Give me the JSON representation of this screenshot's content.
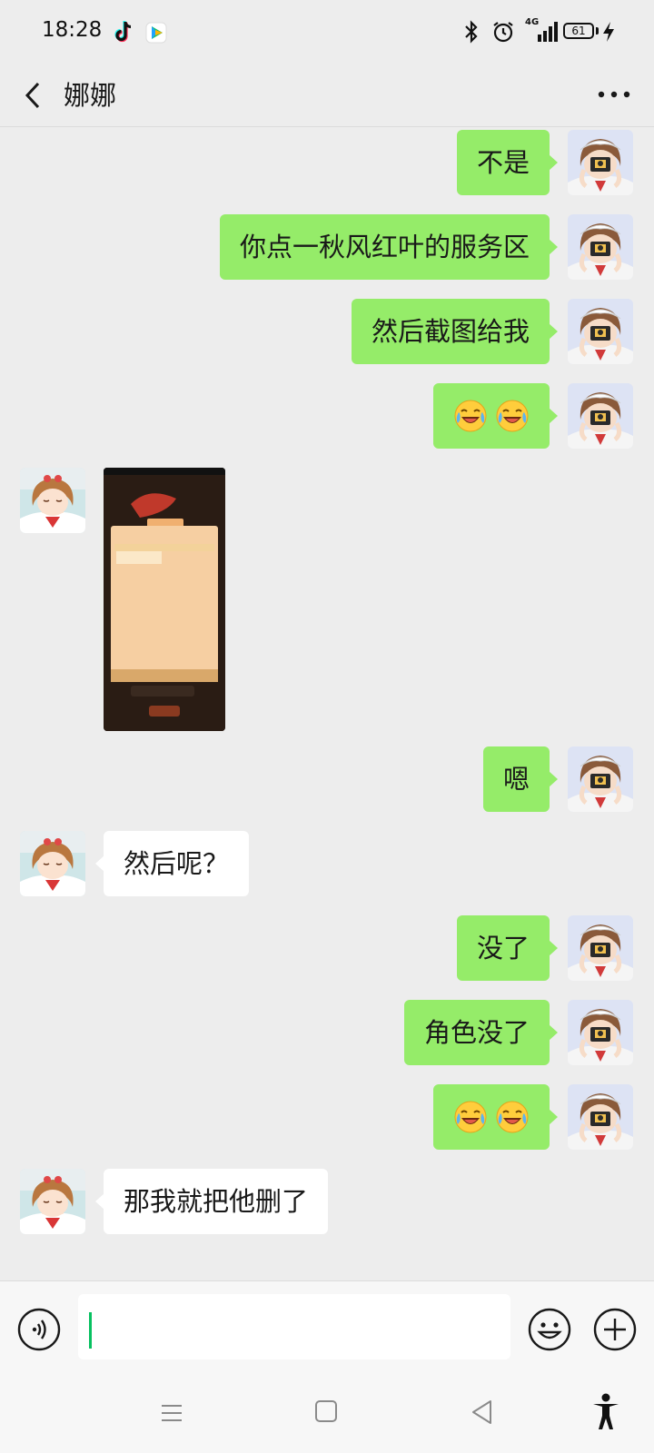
{
  "status_bar": {
    "time": "18:28",
    "network": "4G",
    "battery": "61",
    "battery_level_percent": 61,
    "icons": [
      "tiktok-icon",
      "video-app-icon",
      "bluetooth-icon",
      "alarm-icon",
      "signal-icon",
      "battery-icon",
      "charging-icon"
    ]
  },
  "header": {
    "title": "娜娜",
    "back_icon": "chevron-left-icon",
    "more_icon": "more-dots-icon"
  },
  "messages": [
    {
      "from": "me",
      "type": "text",
      "text": "不是"
    },
    {
      "from": "me",
      "type": "text",
      "text": "你点一秋风红叶的服务区"
    },
    {
      "from": "me",
      "type": "text",
      "text": "然后截图给我"
    },
    {
      "from": "me",
      "type": "emoji",
      "emoji": [
        "laughing-crying-emoji",
        "laughing-crying-emoji"
      ]
    },
    {
      "from": "her",
      "type": "image",
      "image": "game-screenshot-thumbnail"
    },
    {
      "from": "me",
      "type": "text",
      "text": "嗯"
    },
    {
      "from": "her",
      "type": "text",
      "text": "然后呢？"
    },
    {
      "from": "me",
      "type": "text",
      "text": "没了"
    },
    {
      "from": "me",
      "type": "text",
      "text": "角色没了"
    },
    {
      "from": "me",
      "type": "emoji",
      "emoji": [
        "laughing-crying-emoji",
        "laughing-crying-emoji"
      ]
    },
    {
      "from": "her",
      "type": "text",
      "text": "那我就把他删了"
    }
  ],
  "input_bar": {
    "value": "",
    "voice_icon": "voice-icon",
    "emoji_icon": "smiley-icon",
    "plus_icon": "plus-icon"
  },
  "nav_bar": {
    "icons": [
      "menu-icon",
      "home-square-icon",
      "back-triangle-icon",
      "accessibility-icon"
    ]
  },
  "colors": {
    "background": "#ededed",
    "my_bubble": "#95ec69",
    "her_bubble": "#ffffff",
    "caret": "#07c160"
  }
}
